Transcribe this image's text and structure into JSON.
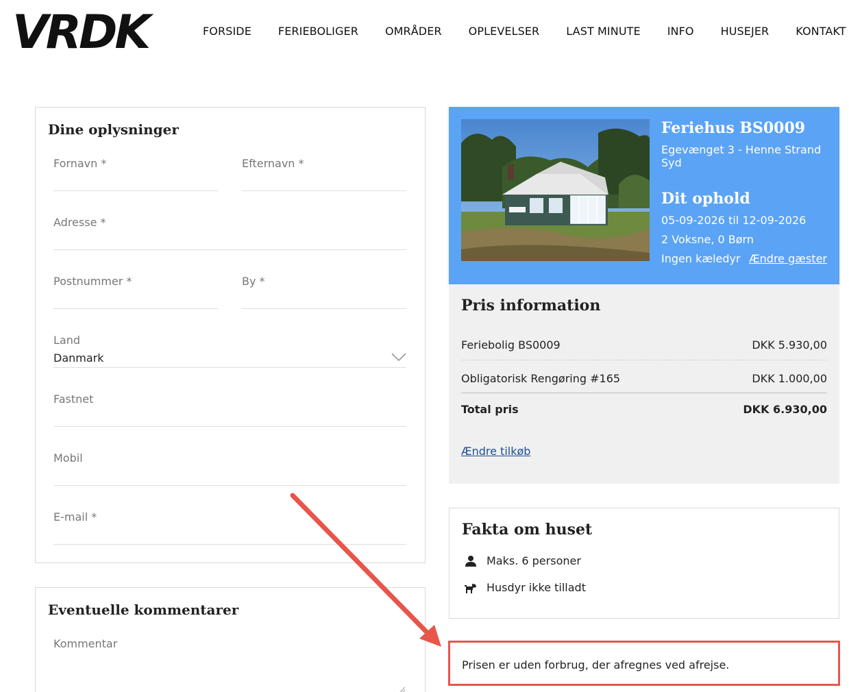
{
  "header": {
    "logo_text": "VRDK",
    "nav": [
      "FORSIDE",
      "FERIEBOLIGER",
      "OMRÅDER",
      "OPLEVELSER",
      "LAST MINUTE",
      "INFO",
      "HUSEJER",
      "KONTAKT"
    ]
  },
  "form": {
    "title": "Dine oplysninger",
    "fields": {
      "first_name": "Fornavn *",
      "last_name": "Efternavn *",
      "address": "Adresse *",
      "postal_code": "Postnummer *",
      "city": "By *",
      "country_label": "Land",
      "country_value": "Danmark",
      "landline": "Fastnet",
      "mobile": "Mobil",
      "email": "E-mail *"
    }
  },
  "comments": {
    "title": "Eventuelle kommentarer",
    "label": "Kommentar"
  },
  "booking": {
    "house_title": "Feriehus BS0009",
    "address": "Egevænget 3 - Henne Strand Syd",
    "stay_title": "Dit ophold",
    "dates": "05-09-2026 til 12-09-2026",
    "guests": "2 Voksne, 0 Børn",
    "pets": "Ingen kæledyr",
    "change_guests": "Ændre gæster"
  },
  "price": {
    "title": "Pris information",
    "rows": [
      {
        "label": "Feriebolig BS0009",
        "amount": "DKK 5.930,00"
      },
      {
        "label": "Obligatorisk Rengøring #165",
        "amount": "DKK 1.000,00"
      }
    ],
    "total_label": "Total pris",
    "total_amount": "DKK 6.930,00",
    "change_addons": "Ændre tilkøb"
  },
  "facts": {
    "title": "Fakta om huset",
    "items": [
      {
        "icon": "person-icon",
        "text": "Maks. 6 personer"
      },
      {
        "icon": "dog-icon",
        "text": "Husdyr ikke tilladt"
      }
    ]
  },
  "note": {
    "text": "Prisen er uden forbrug, der afregnes ved afrejse."
  },
  "colors": {
    "booking_bg": "#5ba3f5",
    "annotation": "#e8554a",
    "link": "#1d4f91"
  }
}
